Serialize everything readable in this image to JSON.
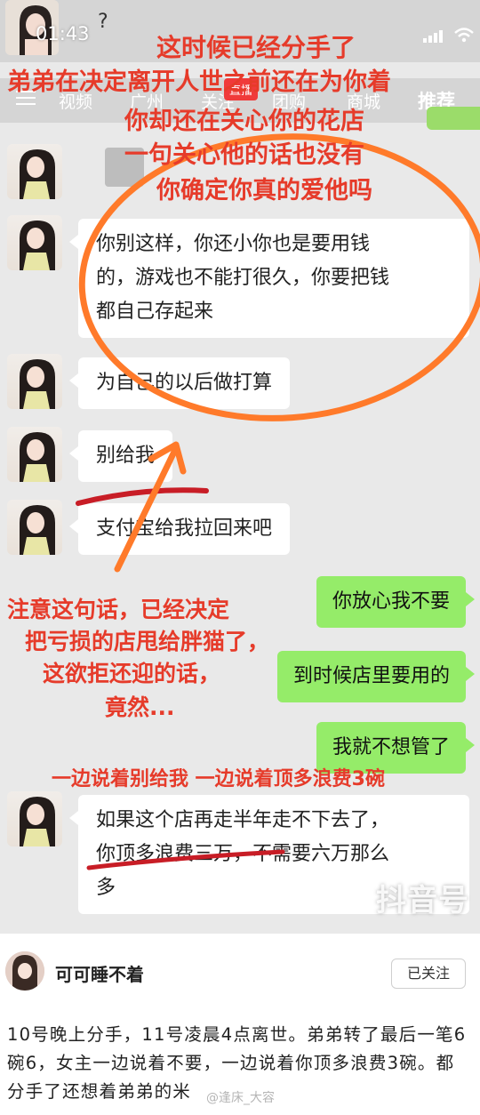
{
  "status_bar": {
    "time": "01:43",
    "extra_glyph": "?"
  },
  "top_nav": {
    "items": [
      "视频",
      "广州",
      "关注",
      "团购",
      "商城",
      "推荐"
    ],
    "live_badge": "直播"
  },
  "annotations_top": [
    "这时候已经分手了",
    "弟弟在决定离开人世之前还在为你着",
    "你却还在关心你的花店",
    "一句关心他的话也没有",
    "你确定你真的爱他吗"
  ],
  "messages": [
    {
      "side": "left",
      "lines": [
        "你别这样，你还小你也是要用钱",
        "的，游戏也不能打很久，你要把钱",
        "都自己存起来"
      ]
    },
    {
      "side": "left",
      "lines": [
        "为自己的以后做打算"
      ]
    },
    {
      "side": "left",
      "lines": [
        "别给我"
      ]
    },
    {
      "side": "left",
      "lines": [
        "支付宝给我拉回来吧"
      ]
    },
    {
      "side": "right",
      "lines": [
        "你放心我不要"
      ]
    },
    {
      "side": "right",
      "lines": [
        "到时候店里要用的"
      ]
    },
    {
      "side": "right",
      "lines": [
        "我就不想管了"
      ]
    },
    {
      "side": "left",
      "lines": [
        "如果这个店再走半年走不下去了，",
        "你顶多浪费三万，不需要六万那么",
        "多"
      ]
    }
  ],
  "annotations_mid": [
    "注意这句话，已经决定",
    "把亏损的店甩给胖猫了，",
    "这欲拒还迎的话，",
    "竟然..."
  ],
  "annotation_bottom": "一边说着别给我 一边说着顶多浪费3碗",
  "watermark": "抖音号",
  "post": {
    "author": "可可睡不着",
    "follow_label": "已关注",
    "text": "10号晚上分手，11号凌晨4点离世。弟弟转了最后一笔6碗6，女主一边说着不要，一边说着你顶多浪费3碗。都分手了还想着弟弟的米",
    "weibo_mark": "@逢床_大容"
  },
  "colors": {
    "annotation": "#e63b2a",
    "circle": "#ff7a2a",
    "underline": "#c81d26",
    "bubble_right": "#95ec69",
    "bubble_left": "#ffffff"
  },
  "icons": [
    "menu-icon",
    "signal-icon",
    "wifi-icon",
    "arrow-icon"
  ]
}
